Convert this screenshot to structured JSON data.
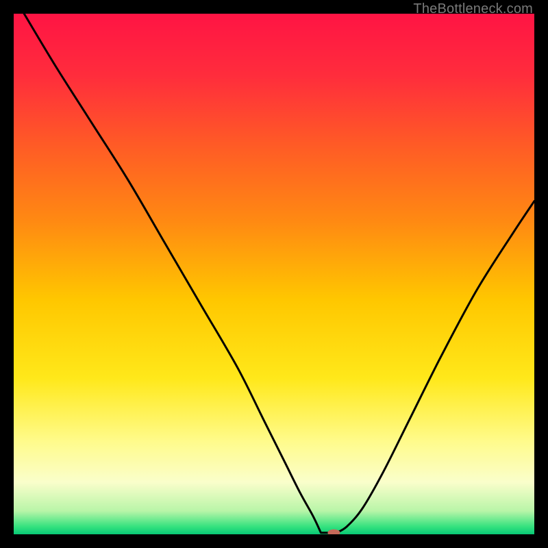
{
  "watermark": "TheBottleneck.com",
  "chart_data": {
    "type": "line",
    "title": "",
    "xlabel": "",
    "ylabel": "",
    "xlim": [
      0,
      100
    ],
    "ylim": [
      0,
      100
    ],
    "grid": false,
    "legend": false,
    "gradient_stops": [
      {
        "offset": 0.0,
        "color": "#ff1444"
      },
      {
        "offset": 0.12,
        "color": "#ff2d3c"
      },
      {
        "offset": 0.25,
        "color": "#ff5a26"
      },
      {
        "offset": 0.4,
        "color": "#ff8a12"
      },
      {
        "offset": 0.55,
        "color": "#ffc700"
      },
      {
        "offset": 0.7,
        "color": "#ffe81a"
      },
      {
        "offset": 0.82,
        "color": "#fffb8a"
      },
      {
        "offset": 0.9,
        "color": "#fafecb"
      },
      {
        "offset": 0.955,
        "color": "#b9f5a8"
      },
      {
        "offset": 0.985,
        "color": "#36e27f"
      },
      {
        "offset": 1.0,
        "color": "#07c975"
      }
    ],
    "series": [
      {
        "name": "bottleneck-curve",
        "x": [
          2,
          8,
          15,
          22,
          29,
          36,
          43,
          48,
          52,
          55,
          57.5,
          59,
          60,
          62,
          64,
          67,
          71,
          76,
          82,
          89,
          96,
          100
        ],
        "y": [
          100,
          90,
          79,
          68,
          56,
          44,
          32,
          22,
          14,
          8,
          3.5,
          1.2,
          0.3,
          0.3,
          1.5,
          5,
          12,
          22,
          34,
          47,
          58,
          64
        ]
      }
    ],
    "curve_min": {
      "x_start": 59,
      "x_end": 62,
      "y": 0.3
    },
    "marker": {
      "x": 61.5,
      "y": 0.3,
      "color": "#c66a5a",
      "rx": 9,
      "ry": 5
    }
  }
}
